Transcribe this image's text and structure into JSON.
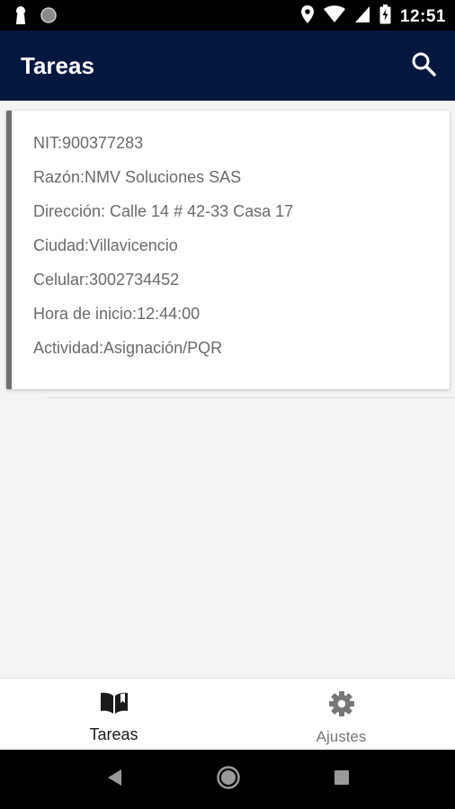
{
  "status_bar": {
    "time": "12:51",
    "icons": [
      "keyhole-icon",
      "circle-notification-icon",
      "location-icon",
      "wifi-icon",
      "signal-icon",
      "battery-charging-icon"
    ]
  },
  "app_bar": {
    "title": "Tareas",
    "search_icon": "search-icon"
  },
  "task": {
    "nit": "NIT:900377283",
    "razon": "Razón:NMV Soluciones SAS",
    "direccion": "Dirección: Calle 14 # 42-33 Casa 17",
    "ciudad": "Ciudad:Villavicencio",
    "celular": "Celular:3002734452",
    "hora_inicio": "Hora de inicio:12:44:00",
    "actividad": "Actividad:Asignación/PQR"
  },
  "bottom_nav": {
    "items": [
      {
        "label": "Tareas",
        "icon": "book-icon",
        "active": true
      },
      {
        "label": "Ajustes",
        "icon": "gear-icon",
        "active": false
      }
    ]
  },
  "system_nav": {
    "buttons": [
      "back-icon",
      "home-icon",
      "recents-icon"
    ]
  },
  "colors": {
    "app_bar": "#04183f",
    "card_accent": "#6f6f6f",
    "background": "#f4f4f4"
  }
}
